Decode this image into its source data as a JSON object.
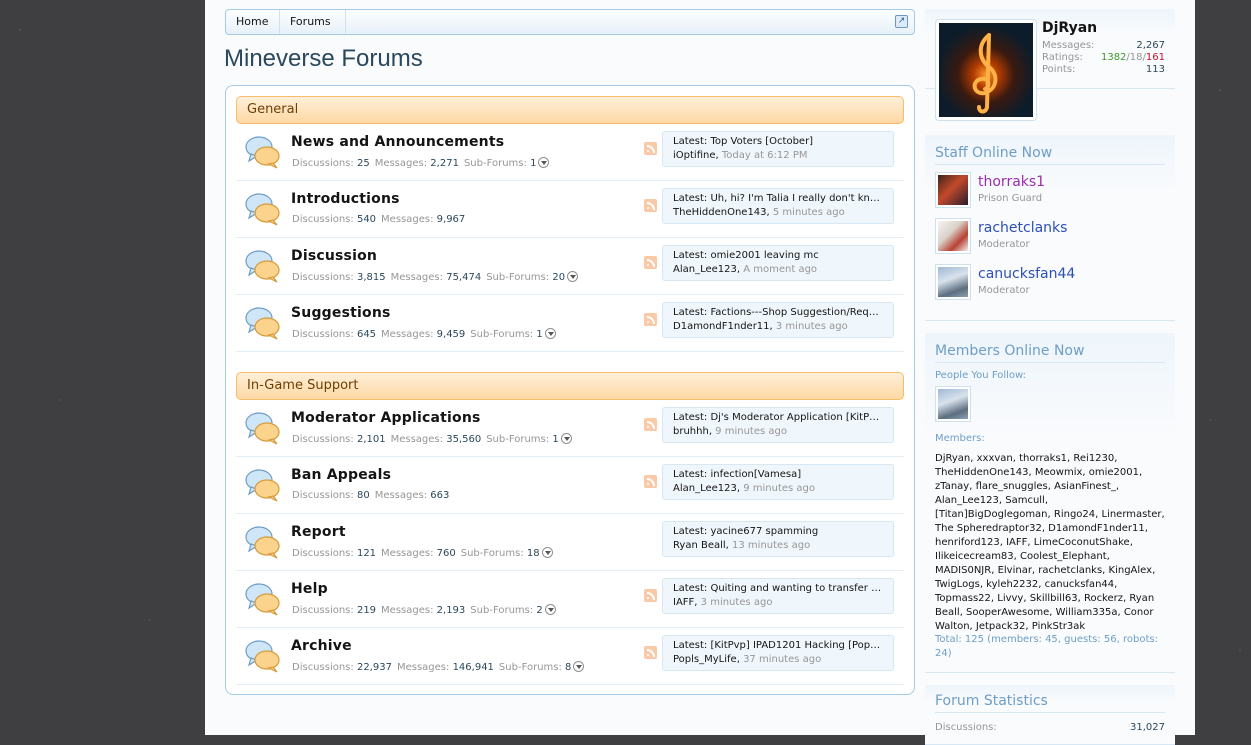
{
  "breadcrumb": {
    "home": "Home",
    "forums": "Forums"
  },
  "page_title": "Mineverse Forums",
  "categories": [
    {
      "name": "General",
      "forums": [
        {
          "title": "News and Announcements",
          "discussions": "25",
          "messages": "2,271",
          "subforums": "1",
          "latest": "Latest: Top Voters [October]",
          "user": "iOptifine",
          "time": "Today at 6:12 PM",
          "rss": true
        },
        {
          "title": "Introductions",
          "discussions": "540",
          "messages": "9,967",
          "subforums": null,
          "latest": "Latest: Uh, hi? I'm Talia I really don't kno...",
          "user": "TheHiddenOne143",
          "time": "5 minutes ago",
          "rss": true
        },
        {
          "title": "Discussion",
          "discussions": "3,815",
          "messages": "75,474",
          "subforums": "20",
          "latest": "Latest: omie2001 leaving mc",
          "user": "Alan_Lee123",
          "time": "A moment ago",
          "rss": true
        },
        {
          "title": "Suggestions",
          "discussions": "645",
          "messages": "9,459",
          "subforums": "1",
          "latest": "Latest: Factions---Shop Suggestion/Requ...",
          "user": "D1amondF1nder11",
          "time": "3 minutes ago",
          "rss": true
        }
      ]
    },
    {
      "name": "In-Game Support",
      "forums": [
        {
          "title": "Moderator Applications",
          "discussions": "2,101",
          "messages": "35,560",
          "subforums": "1",
          "latest": "Latest: Dj's Moderator Application [KitPvp...",
          "user": "bruhhh",
          "time": "9 minutes ago",
          "rss": true
        },
        {
          "title": "Ban Appeals",
          "discussions": "80",
          "messages": "663",
          "subforums": null,
          "latest": "Latest: infection[Vamesa]",
          "user": "Alan_Lee123",
          "time": "9 minutes ago",
          "rss": true
        },
        {
          "title": "Report",
          "discussions": "121",
          "messages": "760",
          "subforums": "18",
          "latest": "Latest: yacine677 spamming",
          "user": "Ryan Beall",
          "time": "13 minutes ago",
          "rss": false
        },
        {
          "title": "Help",
          "discussions": "219",
          "messages": "2,193",
          "subforums": "2",
          "latest": "Latest: Quiting and wanting to transfer r...",
          "user": "IAFF",
          "time": "3 minutes ago",
          "rss": true
        },
        {
          "title": "Archive",
          "discussions": "22,937",
          "messages": "146,941",
          "subforums": "8",
          "latest": "Latest: [KitPvp] IPAD1201 Hacking [Pops]...",
          "user": "Popls_MyLife",
          "time": "37 minutes ago",
          "rss": true
        }
      ]
    }
  ],
  "labels": {
    "discussions": "Discussions:",
    "messages": "Messages:",
    "subforums": "Sub-Forums:"
  },
  "user": {
    "name": "DjRyan",
    "messages_label": "Messages:",
    "messages": "2,267",
    "ratings_label": "Ratings:",
    "ratings_pos": "1382",
    "ratings_neutral": "18",
    "ratings_neg": "161",
    "ratings_sep": "/",
    "points_label": "Points:",
    "points": "113"
  },
  "staff_online": {
    "title": "Staff Online Now",
    "members": [
      {
        "name": "thorraks1",
        "role": "Prison Guard",
        "color": "#9b2fae"
      },
      {
        "name": "rachetclanks",
        "role": "Moderator",
        "color": "#2d4fb8"
      },
      {
        "name": "canucksfan44",
        "role": "Moderator",
        "color": "#2d4fb8"
      }
    ]
  },
  "members_online": {
    "title": "Members Online Now",
    "following_label": "People You Follow:",
    "members_label": "Members:",
    "list": "DjRyan, xxxvan, thorraks1, Rei1230, TheHiddenOne143, Meowmix, omie2001, zTanay, flare_snuggles, AsianFinest_, Alan_Lee123, Samcull, [Titan]BigDoglegoman, Ringo24, Linermaster, The Spheredraptor32, D1amondF1nder11, henriford123, IAFF, LimeCoconutShake, Ilikeicecream83, Coolest_Elephant, MADIS0NJR, Elvinar, rachetclanks, KingAlex, TwigLogs, kyleh2232, canucksfan44, Topmass22, Livvy, Skillbill63, Rockerz, Ryan Beall, SooperAwesome, William335a, Conor Walton, Jetpack32, PinkStr3ak",
    "total": "Total: 125 (members: 45, guests: 56, robots: 24)"
  },
  "forum_stats": {
    "title": "Forum Statistics",
    "discussions_label": "Discussions:",
    "discussions": "31,027"
  },
  "colors": {
    "accent": "#6d9ec7",
    "category_bg": "#fed8a4",
    "border": "#a5cae4"
  }
}
